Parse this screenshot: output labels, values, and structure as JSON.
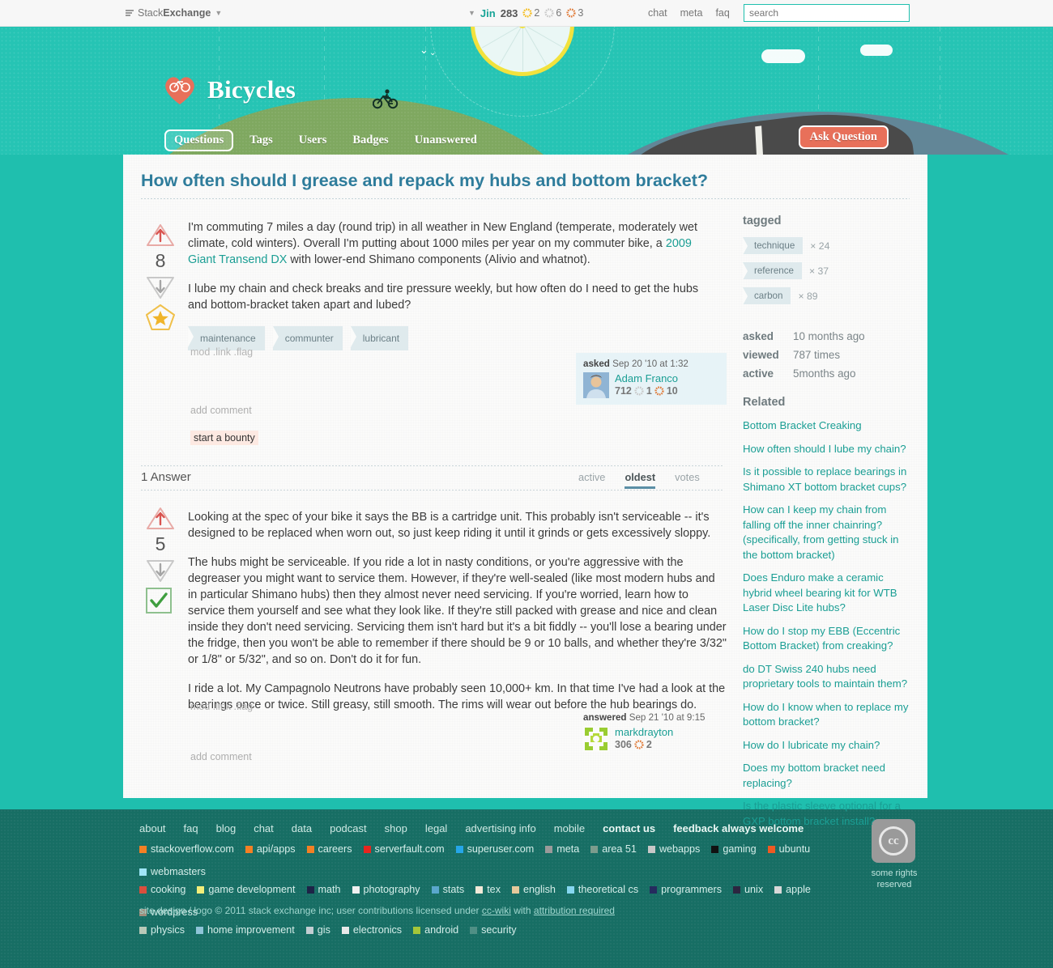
{
  "topbar": {
    "network_label_prefix": "Stack",
    "network_label_bold": "Exchange",
    "network_caret": "▼",
    "user_caret": "▼",
    "username": "Jin",
    "reputation": "283",
    "gold_count": "2",
    "silver_count": "6",
    "bronze_count": "3",
    "links": [
      "chat",
      "meta",
      "faq"
    ],
    "search_placeholder": "search"
  },
  "header": {
    "site_name": "Bicycles",
    "nav": [
      "Questions",
      "Tags",
      "Users",
      "Badges",
      "Unanswered"
    ],
    "active_nav": "Questions",
    "ask_button": "Ask Question"
  },
  "question": {
    "title": "How often should I grease and repack my hubs and bottom bracket?",
    "score": "8",
    "paragraph1_part1": "I'm commuting 7 miles a day (round trip) in all weather in New England (temperate, moderately wet climate, cold winters). Overall I'm putting about 1000 miles per year on my commuter bike, a ",
    "paragraph1_link": "2009 Giant Transend DX",
    "paragraph1_part2": " with lower-end Shimano components (Alivio and whatnot).",
    "paragraph2": "I lube my chain and check breaks and tire pressure weekly, but how often do I need to get the hubs and bottom-bracket taken apart and lubed?",
    "tags": [
      "maintenance",
      "communter",
      "lubricant"
    ],
    "mod_links": "mod .link .flag",
    "add_comment": "add comment",
    "start_bounty": "start a bounty",
    "asked_label": "asked",
    "asked_date": "Sep 20 '10 at 1:32",
    "author": "Adam Franco",
    "author_rep": "712",
    "author_silver": "1",
    "author_bronze": "10"
  },
  "answers": {
    "count_label": "1 Answer",
    "sort_tabs": [
      "active",
      "oldest",
      "votes"
    ],
    "sort_selected": "oldest",
    "items": [
      {
        "score": "5",
        "accepted": true,
        "paragraph1": "Looking at the spec of your bike it says the BB is a cartridge unit. This probably isn't serviceable -- it's designed to be replaced when worn out, so just keep riding it until it grinds or gets excessively sloppy.",
        "paragraph2": "The hubs might be serviceable. If you ride a lot in nasty conditions, or you're aggressive with the degreaser you might want to service them. However, if they're well-sealed (like most modern hubs and in particular Shimano hubs) then they almost never need servicing. If you're worried, learn how to service them yourself and see what they look like. If they're still packed with grease and nice and clean inside they don't need servicing. Servicing them isn't hard but it's a bit fiddly -- you'll lose a bearing under the fridge, then you won't be able to remember if there should be 9 or 10 balls, and whether they're 3/32\" or 1/8\" or 5/32\", and so on. Don't do it for fun.",
        "paragraph3": "I ride a lot. My Campagnolo Neutrons have probably seen 10,000+ km. In that time I've had a look at the bearings once or twice. Still greasy, still smooth. The rims will wear out before the hub bearings do.",
        "mod_links": "mod .link .flag",
        "add_comment": "add comment",
        "answered_label": "answered",
        "answered_date": "Sep 21 '10 at 9:15",
        "author": "markdrayton",
        "author_rep": "306",
        "author_bronze": "2"
      }
    ]
  },
  "sidebar": {
    "tagged_heading": "tagged",
    "tags": [
      {
        "name": "technique",
        "count": "× 24"
      },
      {
        "name": "reference",
        "count": "× 37"
      },
      {
        "name": "carbon",
        "count": "× 89"
      }
    ],
    "stats": [
      {
        "key": "asked",
        "value": "10 months ago"
      },
      {
        "key": "viewed",
        "value": "787 times"
      },
      {
        "key": "active",
        "value": "5months ago"
      }
    ],
    "related_heading": "Related",
    "related": [
      "Bottom Bracket Creaking",
      "How often should I lube my chain?",
      "Is it possible to replace bearings in Shimano XT bottom bracket cups?",
      "How can I keep my chain from falling off the inner chainring? (specifically, from getting stuck in the bottom bracket)",
      "Does Enduro make a ceramic hybrid wheel bearing kit for WTB Laser Disc Lite hubs?",
      "How do I stop my EBB (Eccentric Bottom Bracket) from creaking?",
      "do DT Swiss 240 hubs need proprietary tools to maintain them?",
      "How do I know when to replace my bottom bracket?",
      "How do I lubricate my chain?",
      "Does my bottom bracket need replacing?",
      "Is the plastic sleeve optional for a GXP bottom bracket install?"
    ]
  },
  "footer": {
    "links": [
      "about",
      "faq",
      "blog",
      "chat",
      "data",
      "podcast",
      "shop",
      "legal",
      "advertising info",
      "mobile",
      "contact us",
      "feedback always welcome"
    ],
    "bold_links": [
      "contact us",
      "feedback always welcome"
    ],
    "sites_row1": [
      {
        "name": "stackoverflow.com",
        "color": "#f48024"
      },
      {
        "name": "api/apps",
        "color": "#f48024"
      },
      {
        "name": "careers",
        "color": "#f48024"
      },
      {
        "name": "serverfault.com",
        "color": "#e8251f"
      },
      {
        "name": "superuser.com",
        "color": "#25a6e8"
      },
      {
        "name": "meta",
        "color": "#9a9a9a"
      },
      {
        "name": "area 51",
        "color": "#7c9c8d"
      },
      {
        "name": "webapps",
        "color": "#c8c8c8"
      },
      {
        "name": "gaming",
        "color": "#111111"
      },
      {
        "name": "ubuntu",
        "color": "#f05a22"
      },
      {
        "name": "webmasters",
        "color": "#9fe5f7"
      }
    ],
    "sites_row2": [
      {
        "name": "cooking",
        "color": "#d94f3d"
      },
      {
        "name": "game development",
        "color": "#f2ee7a"
      },
      {
        "name": "math",
        "color": "#1d2447"
      },
      {
        "name": "photography",
        "color": "#f0f0f0"
      },
      {
        "name": "stats",
        "color": "#5aa7cc"
      },
      {
        "name": "tex",
        "color": "#f2e9d8"
      },
      {
        "name": "english",
        "color": "#e5c99b"
      },
      {
        "name": "theoretical cs",
        "color": "#86d7f0"
      },
      {
        "name": "programmers",
        "color": "#252b5e"
      },
      {
        "name": "unix",
        "color": "#2c2640"
      },
      {
        "name": "apple",
        "color": "#d8d8d8"
      },
      {
        "name": "wordpress",
        "color": "#a08e7d"
      }
    ],
    "sites_row3": [
      {
        "name": "physics",
        "color": "#b8c9b8"
      },
      {
        "name": "home improvement",
        "color": "#8ec4d8"
      },
      {
        "name": "gis",
        "color": "#c2cdd2"
      },
      {
        "name": "electronics",
        "color": "#e8e8e8"
      },
      {
        "name": "android",
        "color": "#a4c639"
      },
      {
        "name": "security",
        "color": "#4f8f85"
      }
    ],
    "copyright_part1": "site design / logo © 2011 stack exchange inc; user contributions licensed under ",
    "copyright_link1": "cc-wiki",
    "copyright_part2": " with ",
    "copyright_link2": "attribution required",
    "cc_label": "cc",
    "cc_text": "some rights reserved"
  }
}
